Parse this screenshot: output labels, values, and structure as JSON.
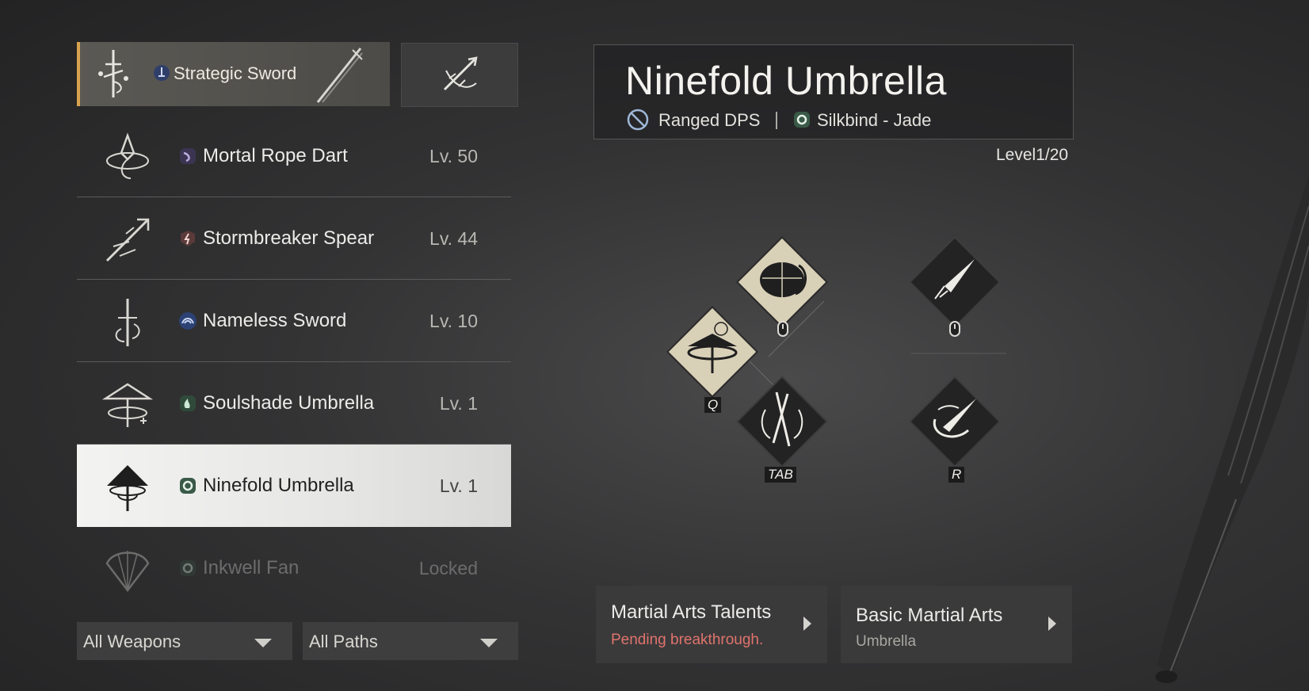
{
  "equipped": {
    "name": "Strategic Sword",
    "weapon_icon": "sword-emblem-icon",
    "path_icon": "bellstrike-path-icon"
  },
  "swap_button": {
    "icon": "swap-weapon-icon"
  },
  "weapons": [
    {
      "name": "Mortal Rope Dart",
      "level": "Lv. 50",
      "icon": "rope-dart-icon",
      "path_color": "#8a7fb8"
    },
    {
      "name": "Stormbreaker Spear",
      "level": "Lv. 44",
      "icon": "spear-icon",
      "path_color": "#b87a78"
    },
    {
      "name": "Nameless Sword",
      "level": "Lv. 10",
      "icon": "sword-icon",
      "path_color": "#5b82c4"
    },
    {
      "name": "Soulshade Umbrella",
      "level": "Lv. 1",
      "icon": "umbrella-icon",
      "path_color": "#78b08c"
    },
    {
      "name": "Ninefold Umbrella",
      "level": "Lv. 1",
      "icon": "umbrella-icon",
      "path_color": "#78b08c",
      "selected": true
    },
    {
      "name": "Inkwell Fan",
      "level": "Locked",
      "icon": "fan-icon",
      "path_color": "#5f7a6a",
      "locked": true
    }
  ],
  "filters": {
    "weapons": "All Weapons",
    "paths": "All Paths"
  },
  "detail": {
    "title": "Ninefold Umbrella",
    "role": "Ranged DPS",
    "path": "Silkbind - Jade",
    "level": "Level1/20"
  },
  "skills": {
    "q_key": "Q",
    "tab_key": "TAB",
    "r_key": "R"
  },
  "panels": {
    "talents_title": "Martial Arts Talents",
    "talents_sub": "Pending breakthrough.",
    "basic_title": "Basic Martial Arts",
    "basic_sub": "Umbrella"
  },
  "colors": {
    "accent": "#d9a24e",
    "warning": "#e0736c"
  }
}
